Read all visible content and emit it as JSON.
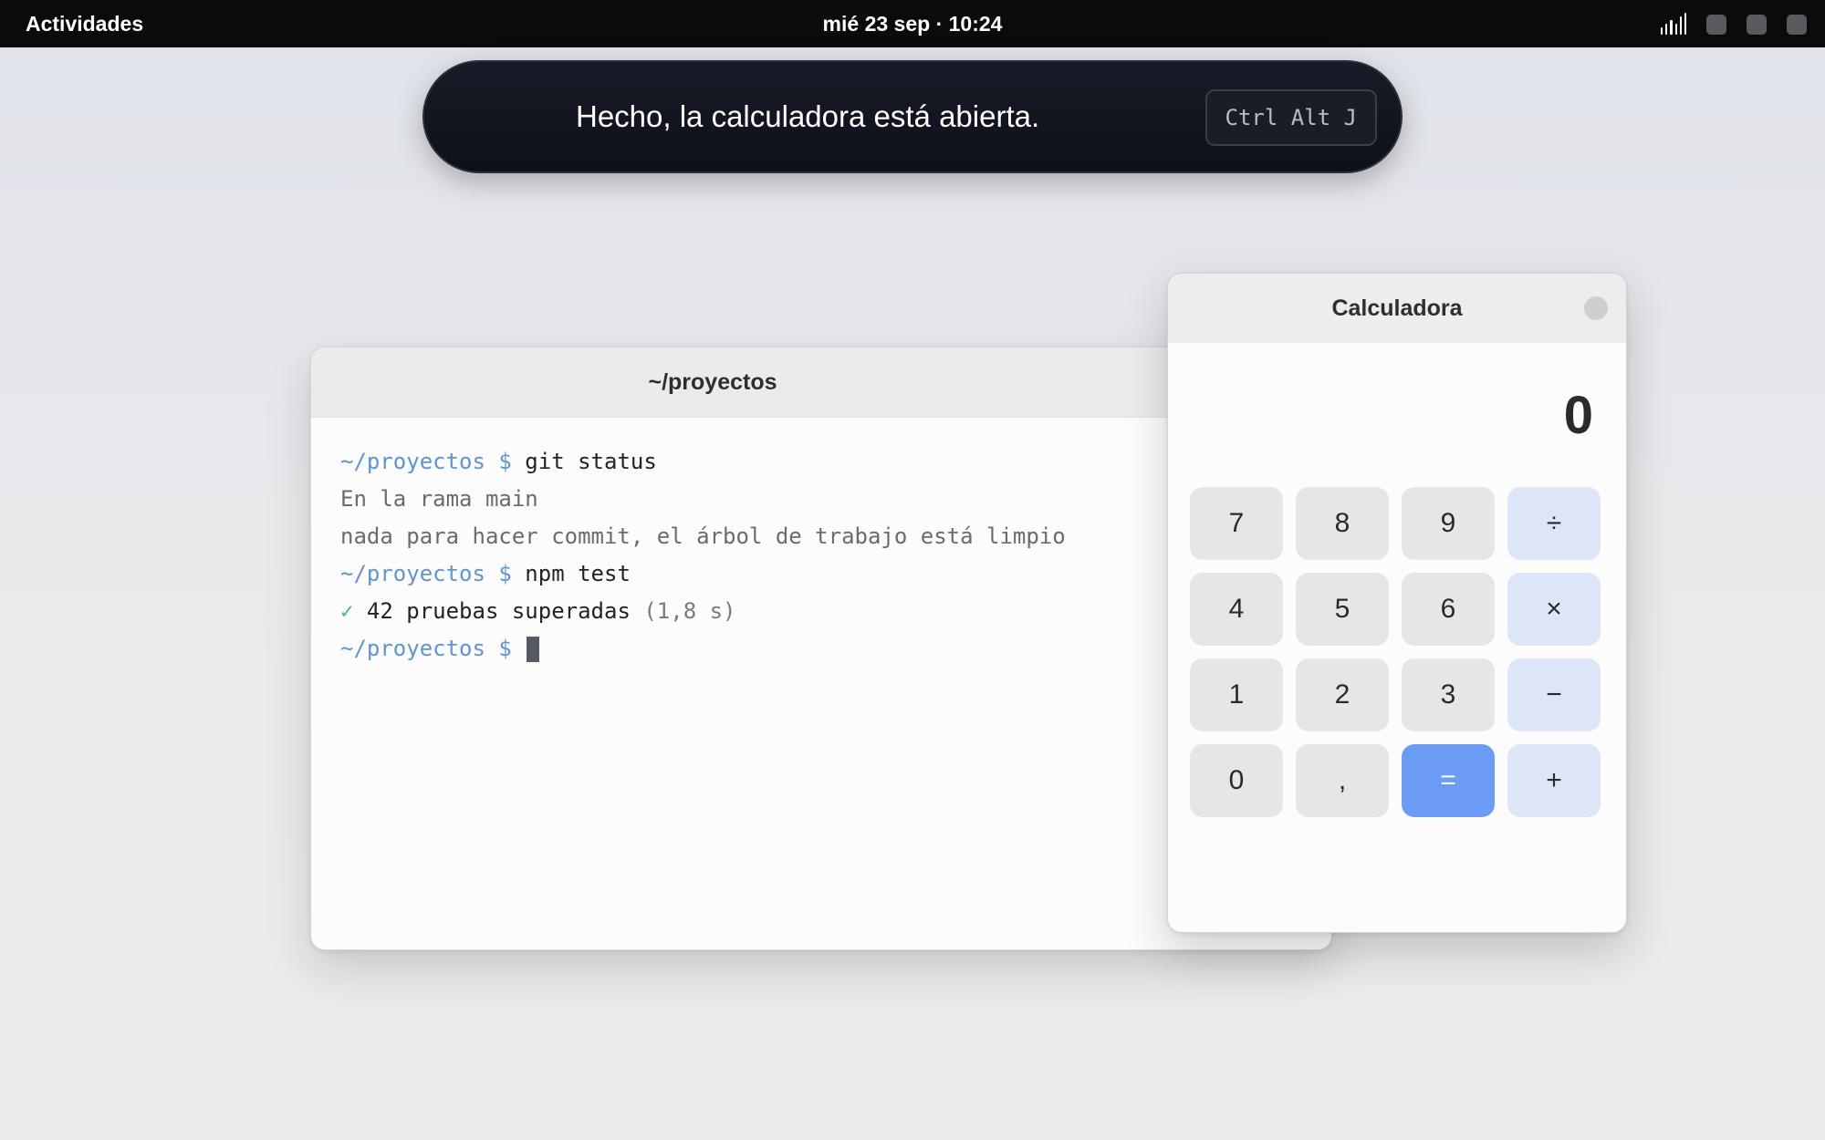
{
  "topbar": {
    "activities": "Actividades",
    "clock": "mié 23 sep · 10:24",
    "tray_icons": [
      "signal-icon",
      "tray-square-icon",
      "tray-square-icon",
      "tray-square-icon"
    ]
  },
  "assistant": {
    "message": "Hecho, la calculadora está abierta.",
    "shortcut": "Ctrl Alt J",
    "icon": "voice-wave-icon",
    "accent_colors": [
      "#8ab4ff",
      "#a78bfa"
    ]
  },
  "terminal": {
    "title": "~/proyectos",
    "lines": [
      {
        "prompt": "~/proyectos $ ",
        "text": "git status"
      },
      {
        "text": "En la rama main"
      },
      {
        "text": "nada para hacer commit, el árbol de trabajo está limpio"
      },
      {
        "prompt": "~/proyectos $ ",
        "text": "npm test"
      },
      {
        "check": "✓ ",
        "text": "42 pruebas superadas",
        "extra": " (1,8 s)"
      },
      {
        "prompt": "~/proyectos $ "
      }
    ]
  },
  "calculator": {
    "title": "Calculadora",
    "display": "0",
    "keys": [
      "7",
      "8",
      "9",
      "÷",
      "4",
      "5",
      "6",
      "×",
      "1",
      "2",
      "3",
      "−",
      "0",
      ",",
      "=",
      "+"
    ],
    "colors": {
      "operator": "#dde6f7",
      "equals": "#6a9cf6",
      "digit": "#e6e6e6"
    }
  }
}
